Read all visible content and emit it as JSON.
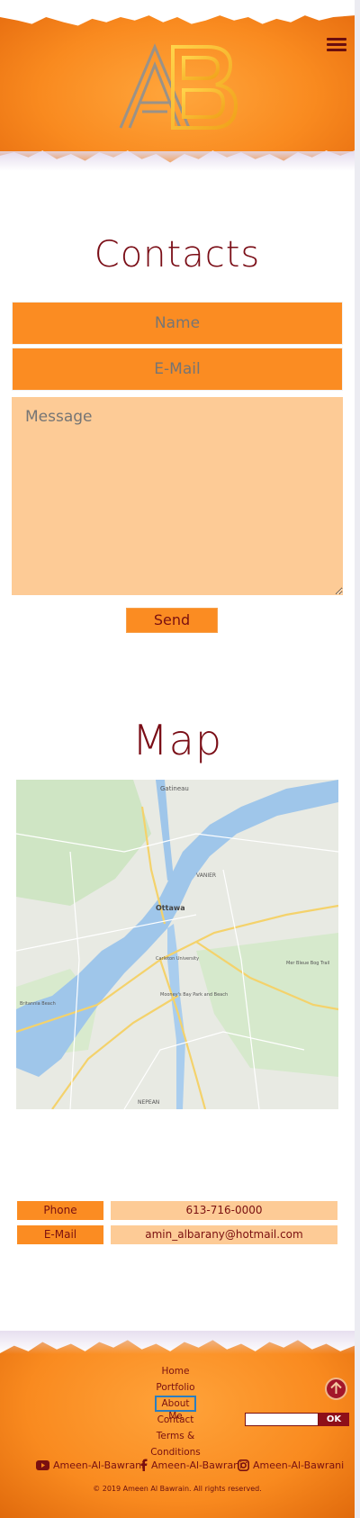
{
  "header": {
    "logo_text": "AB",
    "menu_icon": "hamburger-icon"
  },
  "contacts": {
    "title": "Contacts",
    "name_placeholder": "Name",
    "email_placeholder": "E-Mail",
    "message_placeholder": "Message",
    "send_label": "Send"
  },
  "map": {
    "title": "Map",
    "labels": {
      "gatineau": "Gatineau",
      "vanier": "VANIER",
      "ottawa": "Ottawa",
      "carleton": "Carleton University",
      "nepean": "NEPEAN",
      "mooneys_bay": "Mooney's Bay Park and Beach",
      "britannia": "Britannia Beach",
      "mer_bleue": "Mer Bleue Bog Trail"
    }
  },
  "contact_info": {
    "phone_label": "Phone",
    "phone_value": "613-716-0000",
    "email_label": "E-Mail",
    "email_value": "amin_albarany@hotmail.com"
  },
  "footer": {
    "nav": [
      "Home",
      "Portfolio",
      "About Me",
      "Contact",
      "Terms & Conditions"
    ],
    "ok_label": "OK",
    "social": [
      {
        "icon": "youtube-icon",
        "label": "Ameen-Al-Bawrani"
      },
      {
        "icon": "facebook-icon",
        "label": "Ameen-Al-Bawrani"
      },
      {
        "icon": "instagram-icon",
        "label": "Ameen-Al-Bawrani"
      }
    ],
    "copyright": "© 2019 Ameen Al Bawrain. All rights reserved."
  },
  "colors": {
    "orange": "#fb8c22",
    "peach": "#fdcb96",
    "maroon": "#7a1010",
    "ok_button": "#8e0f19"
  }
}
